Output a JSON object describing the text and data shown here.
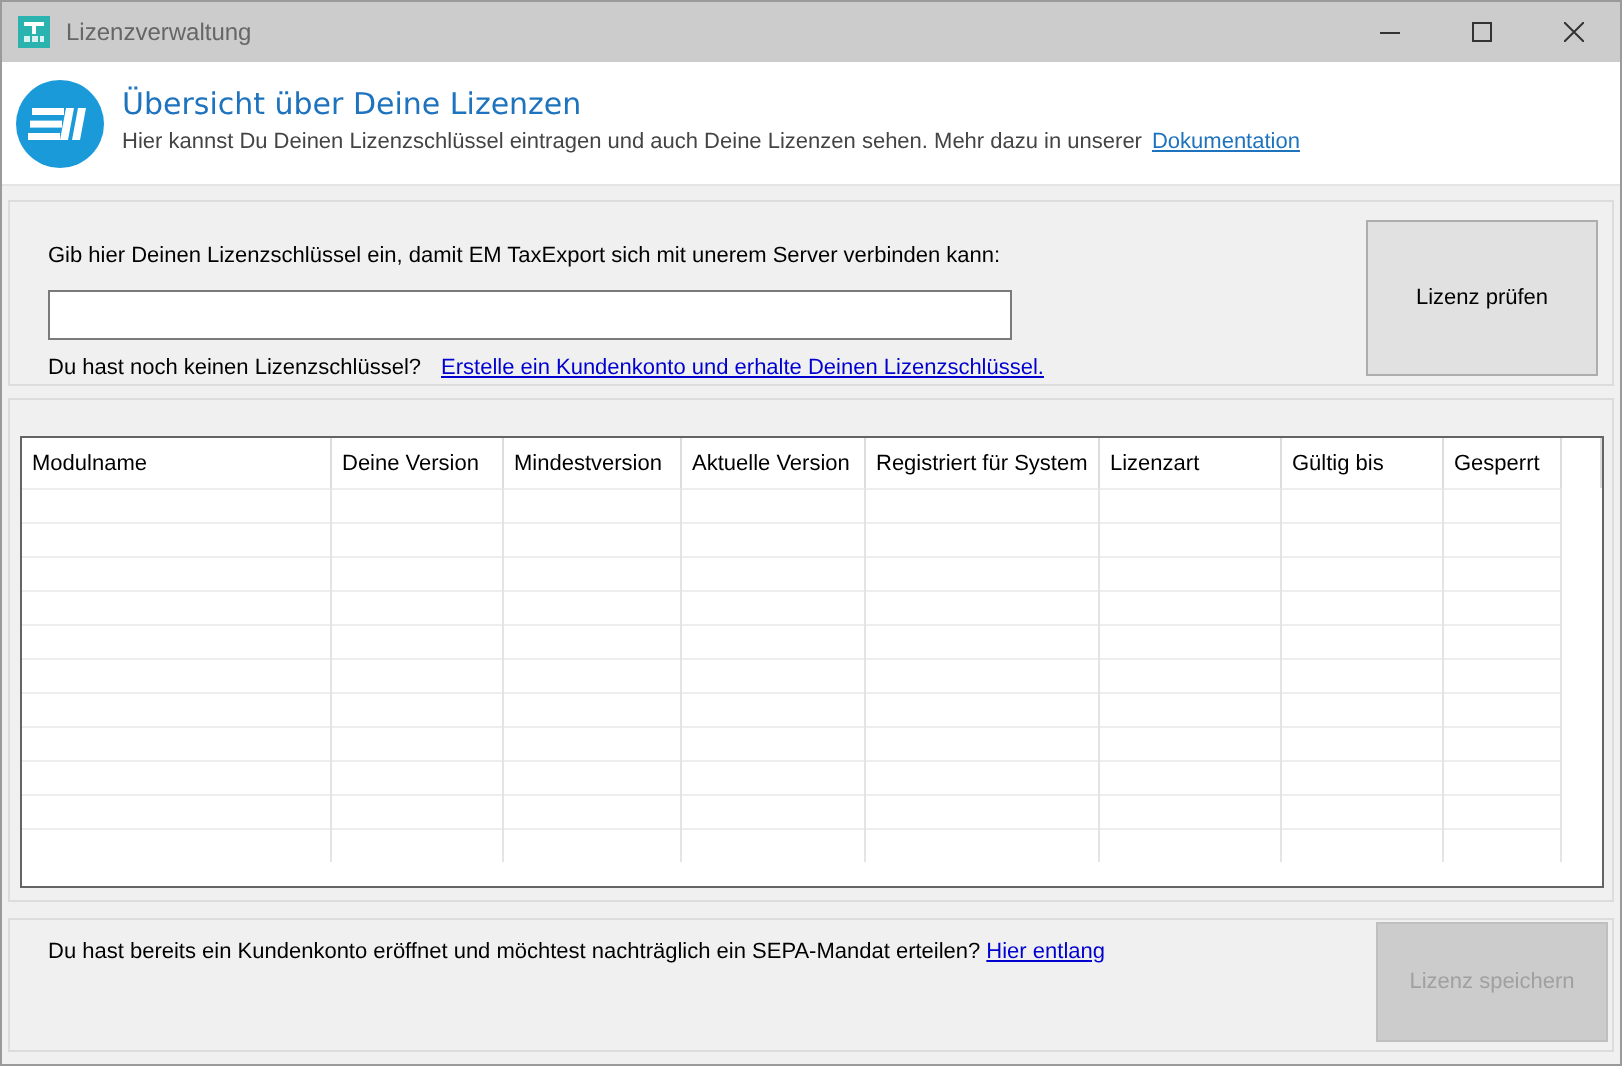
{
  "window": {
    "title": "Lizenzverwaltung"
  },
  "header": {
    "title": "Übersicht über Deine Lizenzen",
    "text": "Hier kannst Du Deinen Lizenzschlüssel eintragen und auch Deine Lizenzen sehen. Mehr dazu in unserer",
    "link": "Dokumentation"
  },
  "key_panel": {
    "label": "Gib hier Deinen Lizenzschlüssel ein, damit EM TaxExport sich mit unerem Server verbinden kann:",
    "hint": "Du hast noch keinen Lizenzschlüssel?",
    "link": "Erstelle ein Kundenkonto und erhalte Deinen Lizenzschlüssel.",
    "button": {
      "label": "Lizenz prüfen",
      "disabled": false
    }
  },
  "table": {
    "columns": [
      "Modulname",
      "Deine Version",
      "Mindestversion",
      "Aktuelle Version",
      "Registriert für System",
      "Lizenzart",
      "Gültig bis",
      "Gesperrt"
    ]
  },
  "footer": {
    "text": "Du hast bereits ein Kundenkonto eröffnet und möchtest nachträglich ein SEPA-Mandat erteilen?",
    "link": "Hier entlang",
    "button": {
      "label": "Lizenz speichern",
      "disabled": true
    }
  }
}
